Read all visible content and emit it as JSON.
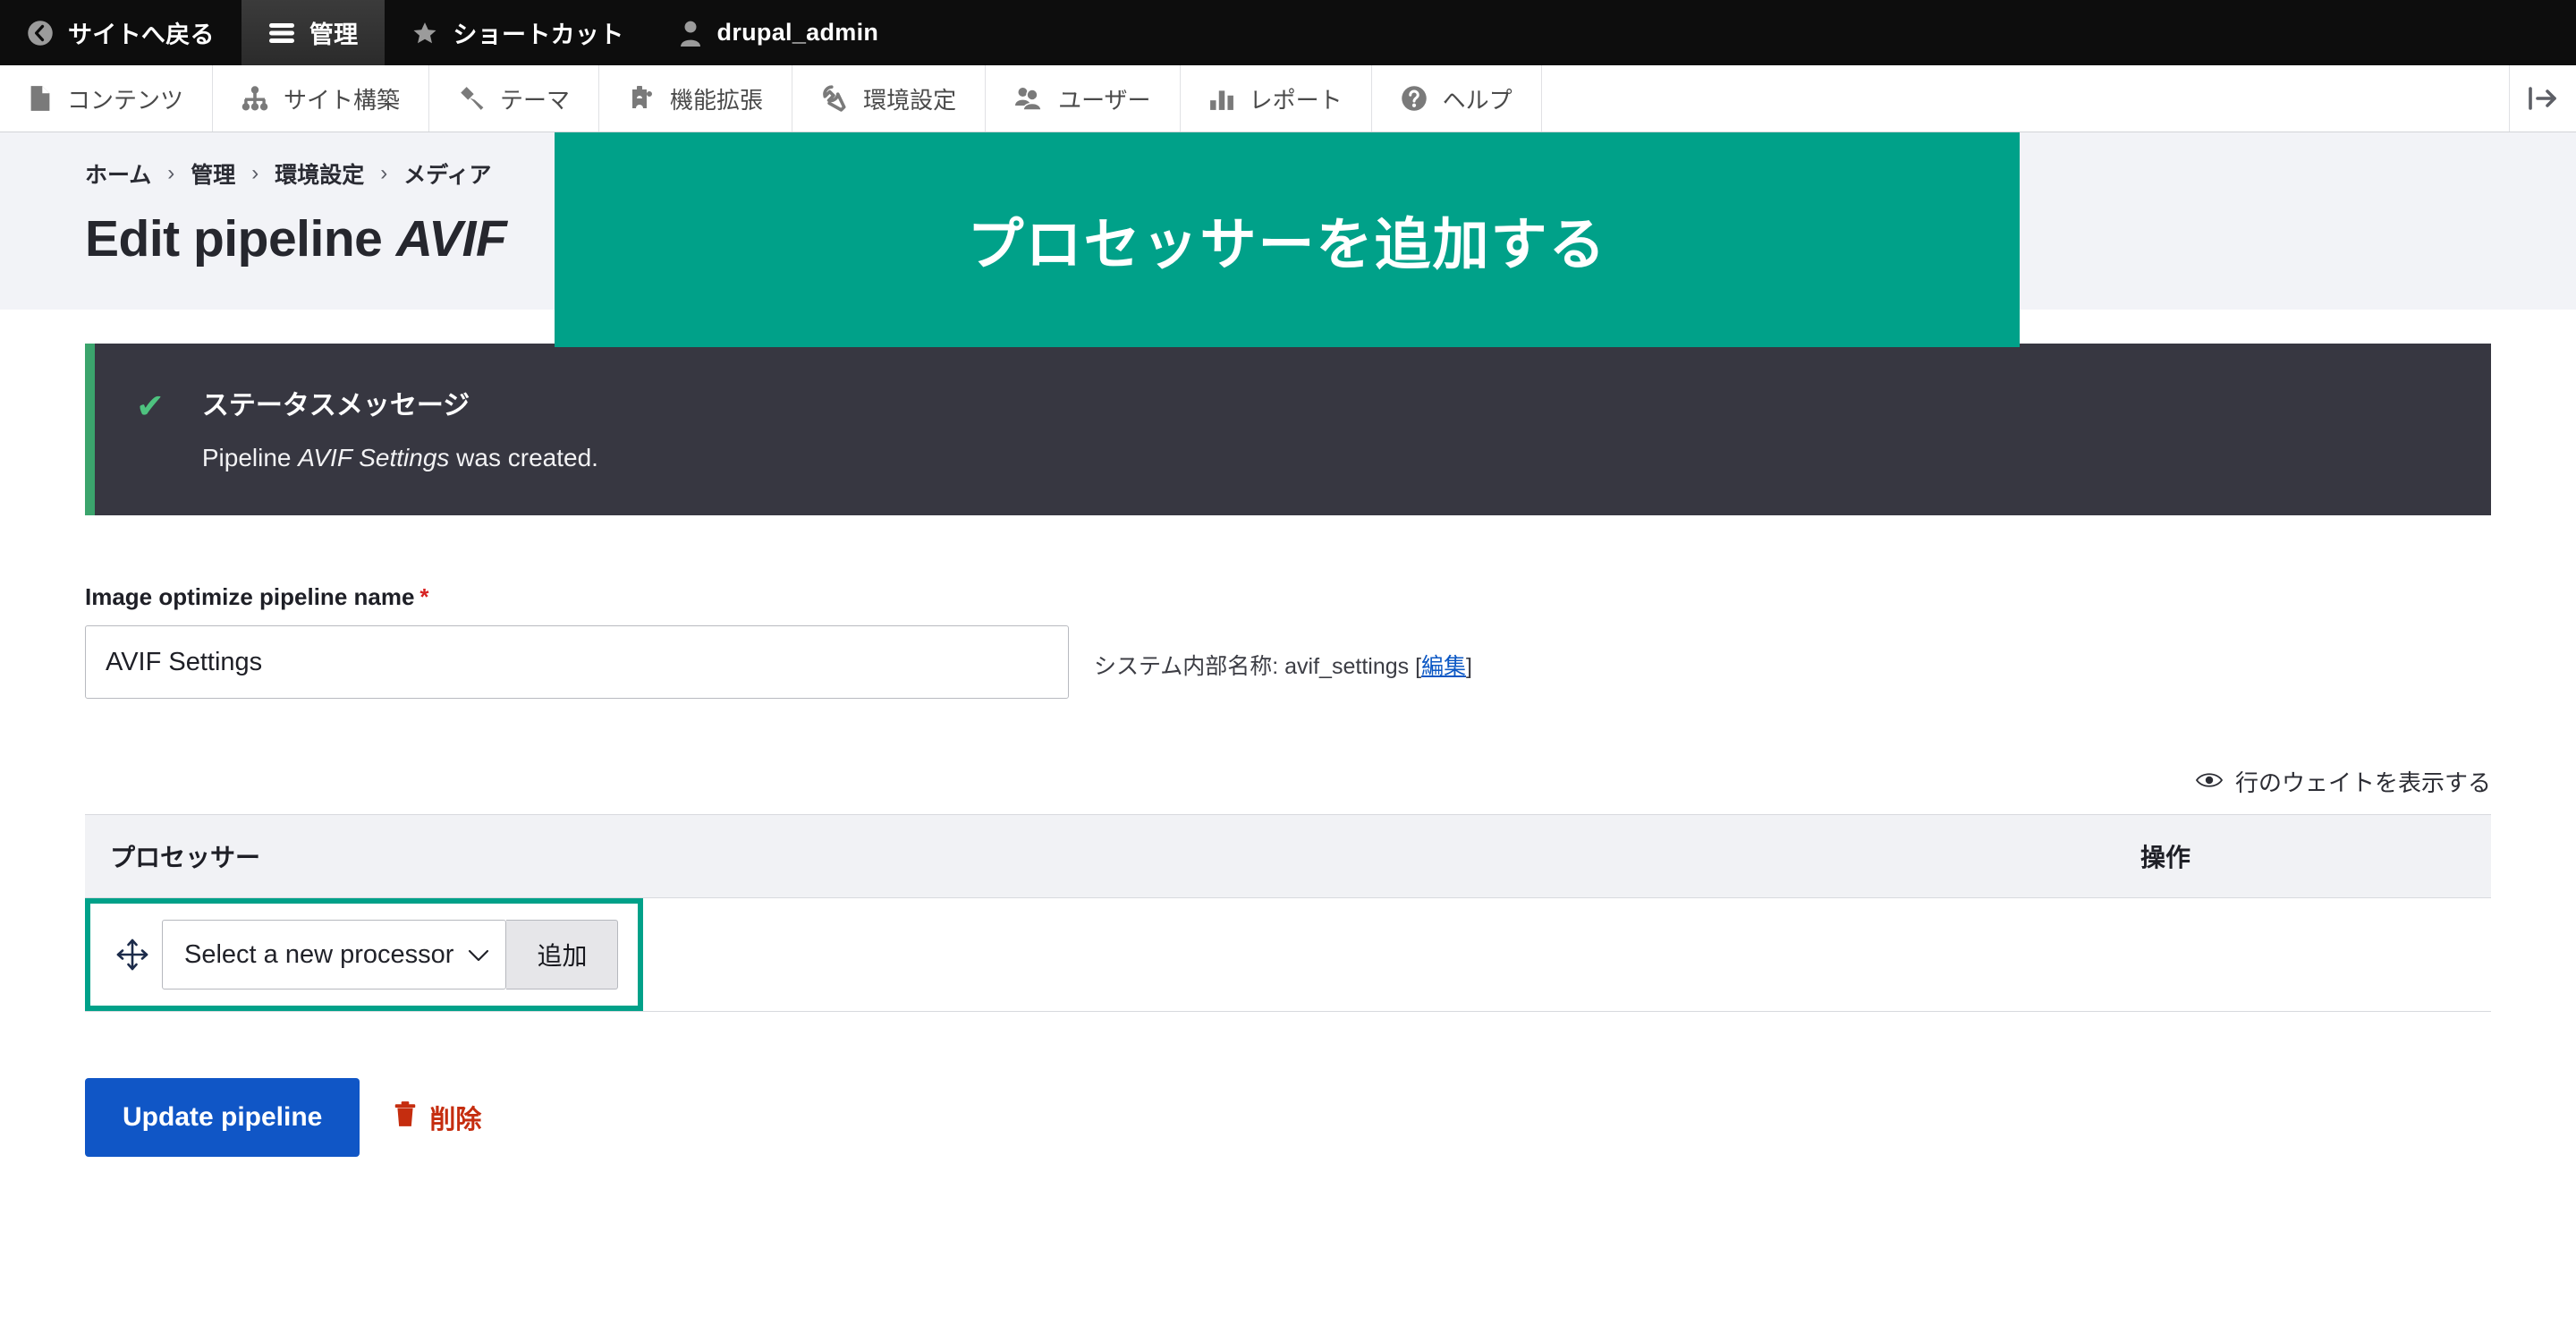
{
  "toolbar": {
    "back_to_site": "サイトへ戻る",
    "manage": "管理",
    "shortcuts": "ショートカット",
    "user": "drupal_admin",
    "icons": {
      "back": "back-circle-icon",
      "hamburger": "hamburger-icon",
      "star": "star-icon",
      "person": "person-icon"
    }
  },
  "menu": {
    "items": [
      {
        "label": "コンテンツ",
        "icon": "file-icon"
      },
      {
        "label": "サイト構築",
        "icon": "sitemap-icon"
      },
      {
        "label": "テーマ",
        "icon": "brush-icon"
      },
      {
        "label": "機能拡張",
        "icon": "puzzle-icon"
      },
      {
        "label": "環境設定",
        "icon": "wrench-icon"
      },
      {
        "label": "ユーザー",
        "icon": "people-icon"
      },
      {
        "label": "レポート",
        "icon": "bar-chart-icon"
      },
      {
        "label": "ヘルプ",
        "icon": "question-mark-icon"
      }
    ],
    "collapse_icon": "collapse-toolbar-icon"
  },
  "breadcrumb": {
    "items": [
      "ホーム",
      "管理",
      "環境設定",
      "メディア"
    ],
    "separator": "›"
  },
  "page": {
    "title_prefix": "Edit pipeline ",
    "title_emphasis": "AVIF"
  },
  "overlay": {
    "text": "プロセッサーを追加する",
    "color": "#00a189"
  },
  "status": {
    "check_icon": "checkmark-icon",
    "title": "ステータスメッセージ",
    "text_before": "Pipeline ",
    "text_emphasis": "AVIF Settings",
    "text_after": " was created.",
    "accent_color": "#3ba46c",
    "background": "#373741"
  },
  "form": {
    "name_label": "Image optimize pipeline name",
    "required_marker": "*",
    "name_value": "AVIF Settings",
    "name_placeholder": "",
    "machine_name_prefix": "システム内部名称: ",
    "machine_name_value": "avif_settings",
    "machine_name_edit_open": "[",
    "machine_name_edit": "編集",
    "machine_name_edit_close": "]"
  },
  "weights": {
    "icon": "eye-icon",
    "label": "行のウェイトを表示する"
  },
  "table": {
    "col_processor": "プロセッサー",
    "col_operations": "操作",
    "row": {
      "drag_icon": "drag-move-icon",
      "select_value": "Select a new processor",
      "select_caret_icon": "chevron-down-icon",
      "add_button": "追加"
    },
    "highlight_color": "#00a189"
  },
  "actions": {
    "update_label": "Update pipeline",
    "delete_icon": "trash-icon",
    "delete_label": "削除",
    "primary_color": "#1056c6",
    "delete_color": "#c52d0f"
  }
}
